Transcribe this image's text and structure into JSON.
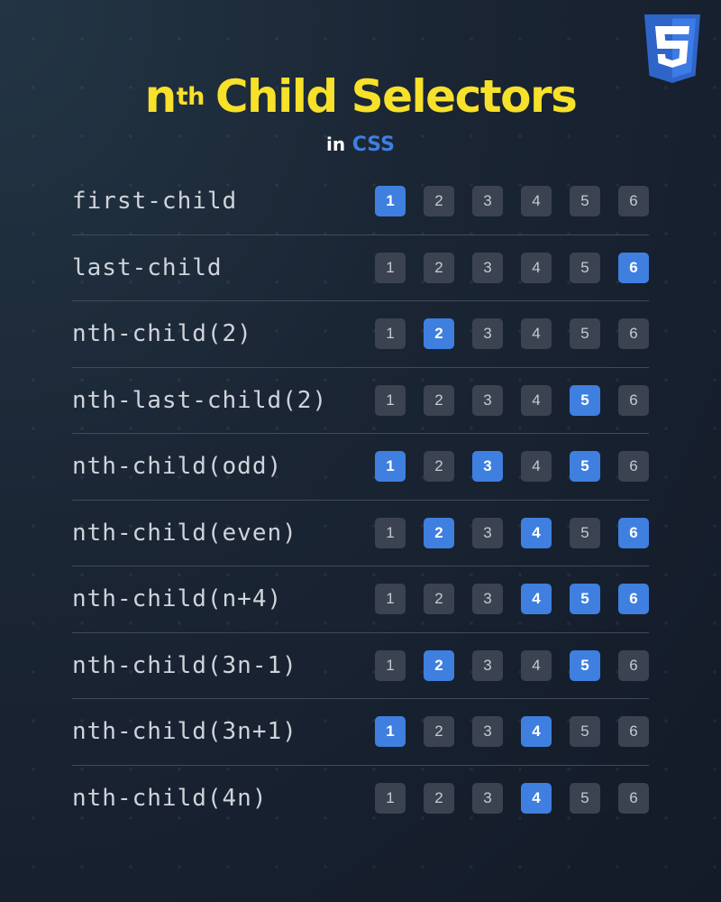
{
  "header": {
    "title_prefix": "n",
    "title_sup": "th",
    "title_main": "Child Selectors",
    "subtitle_in": "in",
    "subtitle_lang": "CSS"
  },
  "logo": {
    "icon": "css3-shield-icon",
    "color": "#2f65c9"
  },
  "colors": {
    "highlight": "#3f7fe0",
    "title": "#f7e12a",
    "box": "#3b4250"
  },
  "rows": [
    {
      "selector": "first-child",
      "selected": [
        1
      ]
    },
    {
      "selector": "last-child",
      "selected": [
        6
      ]
    },
    {
      "selector": "nth-child(2)",
      "selected": [
        2
      ]
    },
    {
      "selector": "nth-last-child(2)",
      "selected": [
        5
      ]
    },
    {
      "selector": "nth-child(odd)",
      "selected": [
        1,
        3,
        5
      ]
    },
    {
      "selector": "nth-child(even)",
      "selected": [
        2,
        4,
        6
      ]
    },
    {
      "selector": "nth-child(n+4)",
      "selected": [
        4,
        5,
        6
      ]
    },
    {
      "selector": "nth-child(3n-1)",
      "selected": [
        2,
        5
      ]
    },
    {
      "selector": "nth-child(3n+1)",
      "selected": [
        1,
        4
      ]
    },
    {
      "selector": "nth-child(4n)",
      "selected": [
        4
      ]
    }
  ],
  "items": [
    "1",
    "2",
    "3",
    "4",
    "5",
    "6"
  ]
}
